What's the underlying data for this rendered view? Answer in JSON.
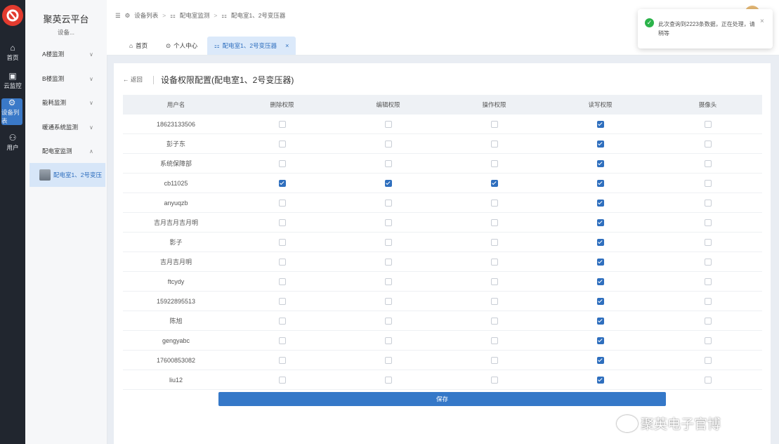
{
  "colors": {
    "accent": "#2f6fbe",
    "rail": "#21262f",
    "success": "#2bb34a"
  },
  "rail": {
    "items": [
      {
        "label": "首页",
        "icon": "home-icon"
      },
      {
        "label": "云监控",
        "icon": "monitor-icon"
      },
      {
        "label": "设备列表",
        "icon": "gear-icon",
        "active": true
      },
      {
        "label": "用户",
        "icon": "user-icon"
      }
    ]
  },
  "sidebar": {
    "title": "聚英云平台",
    "subtitle": "设备...",
    "menu": [
      {
        "label": "A楼监测"
      },
      {
        "label": "B楼监测"
      },
      {
        "label": "能耗监测"
      },
      {
        "label": "暖通系统监测"
      },
      {
        "label": "配电室监测"
      }
    ],
    "submenu": {
      "label": "配电室1、2号变压"
    }
  },
  "breadcrumb": [
    "设备列表",
    "配电室监测",
    "配电室1、2号变压器"
  ],
  "tabs": [
    {
      "label": "首页"
    },
    {
      "label": "个人中心"
    },
    {
      "label": "配电室1、2号变压器",
      "active": true
    }
  ],
  "page": {
    "back": "返回",
    "title": "设备权限配置(配电室1、2号变压器)",
    "save": "保存"
  },
  "table": {
    "columns": [
      "用户名",
      "删除权限",
      "编辑权限",
      "操作权限",
      "读写权限",
      "摄像头"
    ],
    "rows": [
      {
        "user": "18623133506",
        "perms": [
          false,
          false,
          false,
          true,
          false
        ]
      },
      {
        "user": "彭子东",
        "perms": [
          false,
          false,
          false,
          true,
          false
        ]
      },
      {
        "user": "系统保障部",
        "perms": [
          false,
          false,
          false,
          true,
          false
        ]
      },
      {
        "user": "cb11025",
        "perms": [
          true,
          true,
          true,
          true,
          false
        ]
      },
      {
        "user": "anyuqzb",
        "perms": [
          false,
          false,
          false,
          true,
          false
        ]
      },
      {
        "user": "吉月吉月吉月明",
        "perms": [
          false,
          false,
          false,
          true,
          false
        ]
      },
      {
        "user": "影子",
        "perms": [
          false,
          false,
          false,
          true,
          false
        ]
      },
      {
        "user": "吉月吉月明",
        "perms": [
          false,
          false,
          false,
          true,
          false
        ]
      },
      {
        "user": "ftcydy",
        "perms": [
          false,
          false,
          false,
          true,
          false
        ]
      },
      {
        "user": "15922895513",
        "perms": [
          false,
          false,
          false,
          true,
          false
        ]
      },
      {
        "user": "陈旭",
        "perms": [
          false,
          false,
          false,
          true,
          false
        ]
      },
      {
        "user": "gengyabc",
        "perms": [
          false,
          false,
          false,
          true,
          false
        ]
      },
      {
        "user": "17600853082",
        "perms": [
          false,
          false,
          false,
          true,
          false
        ]
      },
      {
        "user": "liu12",
        "perms": [
          false,
          false,
          false,
          true,
          false
        ]
      }
    ]
  },
  "toast": {
    "message": "此次查询到2223条数据，正在处理，请稍等",
    "icon": "check-circle-icon"
  },
  "watermark": {
    "text": "聚英电子官博",
    "icon": "weibo-icon"
  }
}
